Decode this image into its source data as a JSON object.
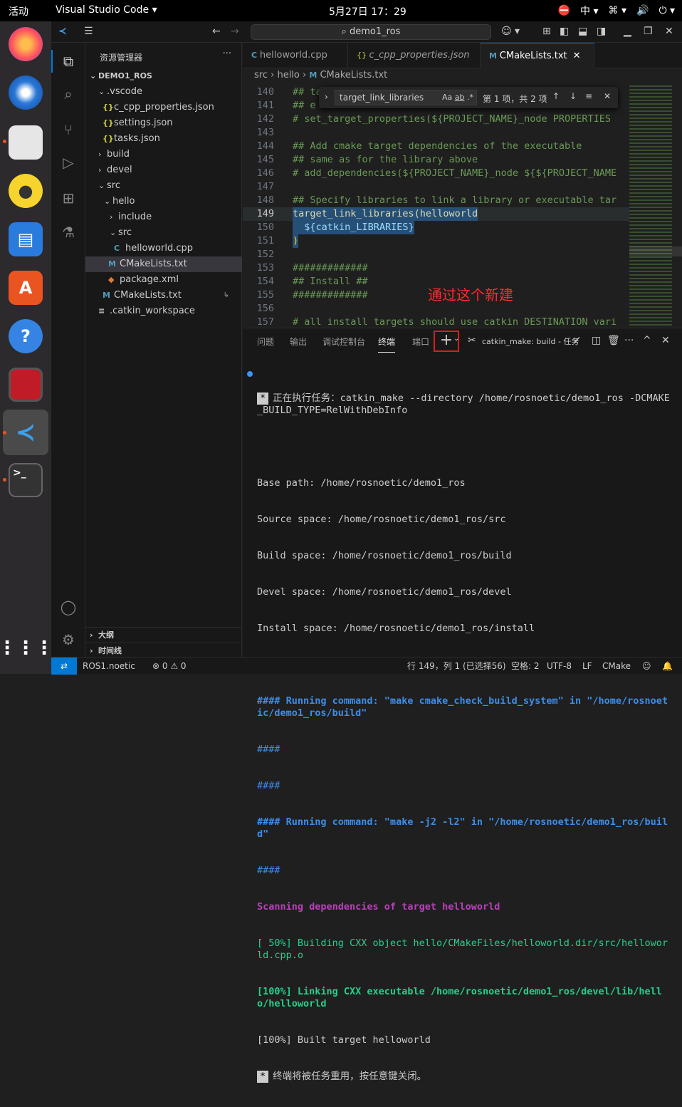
{
  "topbar": {
    "activities": "活动",
    "app_name": "Visual Studio Code",
    "clock": "5月27日  17：29",
    "lang": "中"
  },
  "titlebar": {
    "search": "demo1_ros"
  },
  "sidebar": {
    "title": "资源管理器",
    "root": "DEMO1_ROS",
    "items": [
      {
        "label": ".vscode",
        "icon": "chevron-down"
      },
      {
        "label": "c_cpp_properties.json",
        "icon": "{}"
      },
      {
        "label": "settings.json",
        "icon": "{}"
      },
      {
        "label": "tasks.json",
        "icon": "{}"
      },
      {
        "label": "build",
        "icon": "chevron-right"
      },
      {
        "label": "devel",
        "icon": "chevron-right"
      },
      {
        "label": "src",
        "icon": "chevron-down"
      },
      {
        "label": "hello",
        "icon": "chevron-down"
      },
      {
        "label": "include",
        "icon": "chevron-right"
      },
      {
        "label": "src",
        "icon": "chevron-down"
      },
      {
        "label": "helloworld.cpp",
        "icon": "C"
      },
      {
        "label": "CMakeLists.txt",
        "icon": "M"
      },
      {
        "label": "package.xml",
        "icon": "xml"
      },
      {
        "label": "CMakeLists.txt",
        "icon": "M"
      },
      {
        "label": ".catkin_workspace",
        "icon": "lines"
      }
    ],
    "outline": "大纲",
    "timeline": "时间线"
  },
  "editor": {
    "tabs": [
      "helloworld.cpp",
      "c_cpp_properties.json",
      "CMakeLists.txt"
    ],
    "breadcrumb": [
      "src",
      "hello",
      "CMakeLists.txt"
    ],
    "find": {
      "query": "target_link_libraries",
      "result": "第 1 项，共 2 项"
    },
    "lines": [
      {
        "n": "140",
        "t": "## ta"
      },
      {
        "n": "141",
        "t": "## e"
      },
      {
        "n": "142",
        "t": "# set_target_properties(${PROJECT_NAME}_node PROPERTIES"
      },
      {
        "n": "143",
        "t": ""
      },
      {
        "n": "144",
        "t": "## Add cmake target dependencies of the executable"
      },
      {
        "n": "145",
        "t": "## same as for the library above"
      },
      {
        "n": "146",
        "t": "# add_dependencies(${PROJECT_NAME}_node ${${PROJECT_NAME"
      },
      {
        "n": "147",
        "t": ""
      },
      {
        "n": "148",
        "t": "## Specify libraries to link a library or executable tar"
      },
      {
        "n": "149",
        "t": "target_link_libraries(helloworld"
      },
      {
        "n": "150",
        "t": "  ${catkin_LIBRARIES}"
      },
      {
        "n": "151",
        "t": ")"
      },
      {
        "n": "152",
        "t": ""
      },
      {
        "n": "153",
        "t": "#############"
      },
      {
        "n": "154",
        "t": "## Install ##"
      },
      {
        "n": "155",
        "t": "#############"
      },
      {
        "n": "156",
        "t": ""
      },
      {
        "n": "157",
        "t": "# all install targets should use catkin DESTINATION vari"
      }
    ]
  },
  "annotation": "通过这个新建",
  "panel": {
    "tabs": [
      "问题",
      "输出",
      "调试控制台",
      "终端",
      "端口"
    ],
    "task": "catkin_make: build - 任务",
    "terminal": [
      "正在执行任务：catkin_make --directory /home/rosnoetic/demo1_ros -DCMAKE_BUILD_TYPE=RelWithDebInfo",
      "",
      "Base path: /home/rosnoetic/demo1_ros",
      "Source space: /home/rosnoetic/demo1_ros/src",
      "Build space: /home/rosnoetic/demo1_ros/build",
      "Devel space: /home/rosnoetic/demo1_ros/devel",
      "Install space: /home/rosnoetic/demo1_ros/install",
      "####",
      "#### Running command: \"make cmake_check_build_system\" in \"/home/rosnoetic/demo1_ros/build\"",
      "####",
      "####",
      "#### Running command: \"make -j2 -l2\" in \"/home/rosnoetic/demo1_ros/build\"",
      "####",
      "Scanning dependencies of target helloworld",
      "[ 50%] Building CXX object hello/CMakeFiles/helloworld.dir/src/helloworld.cpp.o",
      "[100%] Linking CXX executable /home/rosnoetic/demo1_ros/devel/lib/hello/helloworld",
      "[100%] Built target helloworld",
      "终端将被任务重用，按任意键关闭。"
    ]
  },
  "statusbar": {
    "remote": "ROS1.noetic",
    "problems": "⊗ 0 ⚠ 0",
    "position": "行 149，列 1 (已选择56)",
    "spaces": "空格: 2",
    "encoding": "UTF-8",
    "eol": "LF",
    "language": "CMake"
  }
}
